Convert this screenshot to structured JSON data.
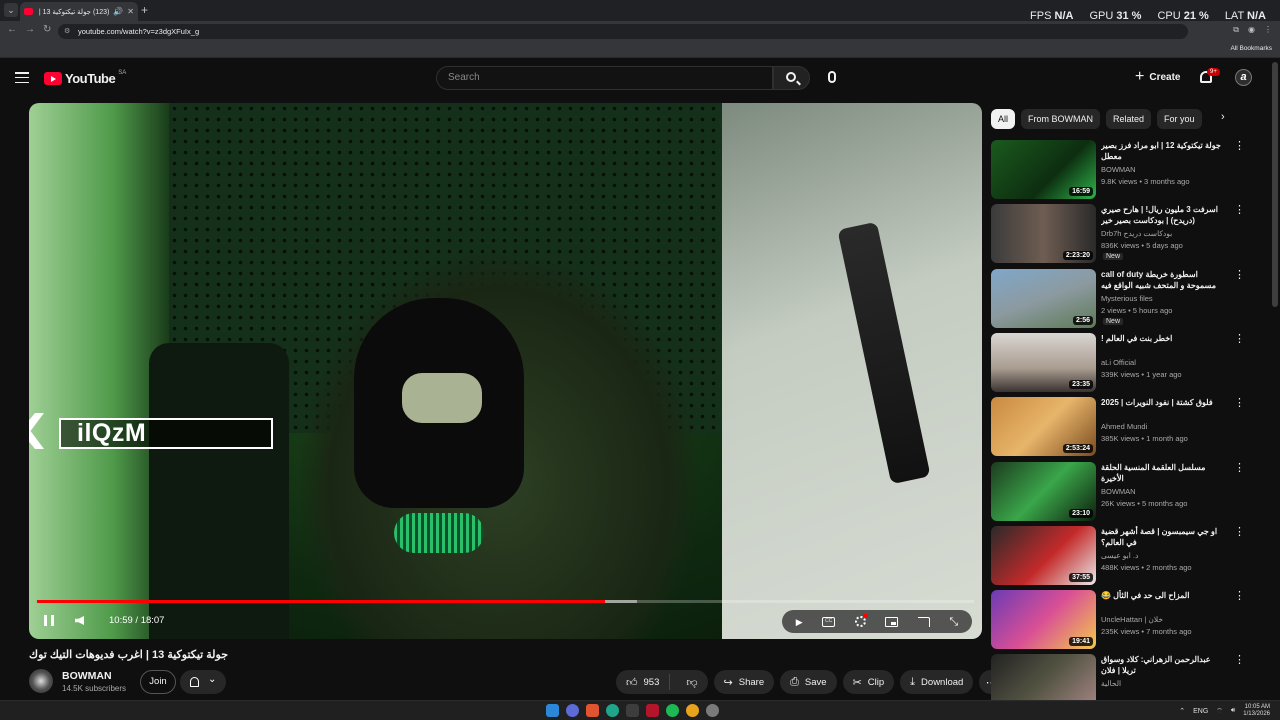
{
  "browser": {
    "tab_title": "(123) جولة تيكتوكية 13 | اغر...",
    "url": "youtube.com/watch?v=z3dgXFuIx_g",
    "bookmarks_label": "All Bookmarks",
    "stats": [
      {
        "label": "FPS",
        "value": "N/A"
      },
      {
        "label": "GPU",
        "value": "31 %"
      },
      {
        "label": "CPU",
        "value": "21 %"
      },
      {
        "label": "LAT",
        "value": "N/A"
      }
    ]
  },
  "header": {
    "logo_text": "YouTube",
    "country_code": "SA",
    "search_placeholder": "Search",
    "create_label": "Create",
    "notifications_badge": "9+",
    "avatar_letter": "a"
  },
  "player": {
    "overlay_name": "ilQzM",
    "current_time": "10:59",
    "duration": "18:07",
    "time_display": "10:59 / 18:07",
    "progress_played": 0.6066,
    "progress_loaded": 0.64
  },
  "video": {
    "title": "جولة تيكتوكية 13 | اغرب فديوهات التيك توك",
    "channel_name": "BOWMAN",
    "subscribers": "14.5K subscribers",
    "join_label": "Join",
    "like_count": "953",
    "share_label": "Share",
    "save_label": "Save",
    "clip_label": "Clip",
    "download_label": "Download"
  },
  "sidebar": {
    "chips": [
      "All",
      "From BOWMAN",
      "Related",
      "For you"
    ],
    "recommendations": [
      {
        "title": "جولة تيكتوكية 12 | ابو مراد فرز بصير معطل",
        "channel": "BOWMAN",
        "meta": "9.8K views • 3 months ago",
        "duration": "16:59",
        "is_new": false,
        "thumb": "t1"
      },
      {
        "title": "اسرفت 3 مليون ريال! | هارح صيري (دريدح) | بودكاست بصير خير",
        "channel": "Drb7h بودكاست دريدح",
        "meta": "836K views • 5 days ago",
        "duration": "2:23:20",
        "is_new": true,
        "new_label": "New",
        "thumb": "t2"
      },
      {
        "title": "اسطورة خريطة call of duty مسموحة و المتحف شبيه الواقع فيه أسترداد لتين",
        "channel": "Mysterious files",
        "meta": "2 views • 5 hours ago",
        "duration": "2:56",
        "is_new": true,
        "new_label": "New",
        "thumb": "t3"
      },
      {
        "title": "اخطر بنت في العالم !",
        "channel": "aLi Official",
        "meta": "339K views • 1 year ago",
        "duration": "23:35",
        "is_new": false,
        "thumb": "t4"
      },
      {
        "title": "فلوق كشتة | نفود النويرات | 2025",
        "channel": "Ahmed Mundi",
        "meta": "385K views • 1 month ago",
        "duration": "2:53:24",
        "is_new": false,
        "thumb": "t5"
      },
      {
        "title": "مسلسل العلقمة المنسية الحلقة الأخيرة",
        "channel": "BOWMAN",
        "meta": "26K views • 5 months ago",
        "duration": "23:10",
        "is_new": false,
        "thumb": "t6"
      },
      {
        "title": "او جي سيمبسون | قصة أشهر قضية في العالم؟",
        "channel": "د. ابو عيسى",
        "meta": "488K views • 2 months ago",
        "duration": "37:55",
        "is_new": false,
        "thumb": "t7"
      },
      {
        "title": "المزاح الى حد في الثأل 😂",
        "channel": "UncleHattan | خلان",
        "meta": "235K views • 7 months ago",
        "duration": "19:41",
        "is_new": false,
        "thumb": "t8"
      },
      {
        "title": "عبدالرحمن الزهراني: كلاد وسواق تريلا | فلان",
        "channel": "الحالية",
        "meta": "",
        "duration": "",
        "is_new": false,
        "thumb": "t9"
      }
    ]
  },
  "taskbar": {
    "language": "ENG",
    "time": "10:05 AM",
    "date": "1/13/2026"
  },
  "colors": {
    "accent_red": "#ff0033",
    "background": "#0f0f0f",
    "chip_active": "#f1f1f1"
  },
  "icons": [
    "menu-icon",
    "search-icon",
    "mic-icon",
    "plus-icon",
    "bell-icon",
    "pause-icon",
    "volume-icon",
    "play-next-icon",
    "captions-icon",
    "settings-icon",
    "miniplayer-icon",
    "cast-icon",
    "fullscreen-icon",
    "like-icon",
    "dislike-icon",
    "share-icon",
    "save-icon",
    "clip-icon",
    "download-icon",
    "more-icon"
  ]
}
